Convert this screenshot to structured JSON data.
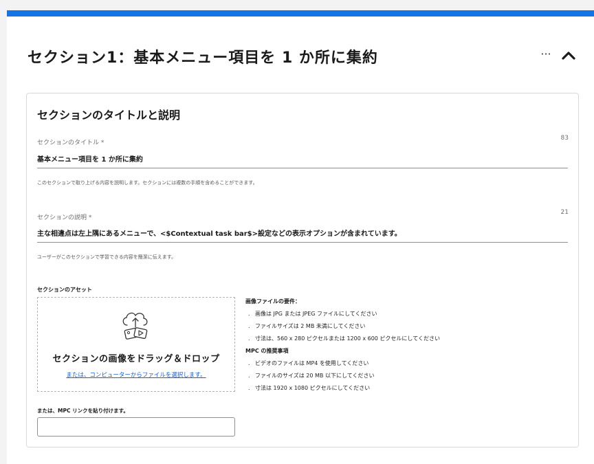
{
  "header": {
    "title": "セクション1：基本メニュー項目を 1 か所に集約",
    "more_label": "···"
  },
  "section": {
    "subtitle": "セクションのタイトルと説明",
    "title_field": {
      "label": "セクションのタイトル *",
      "counter": "83",
      "value": "基本メニュー項目を 1 か所に集約",
      "help": "このセクションで取り上げる内容を説明します。セクションには複数の手順を含めることができます。"
    },
    "description_field": {
      "label": "セクションの説明 *",
      "counter": "21",
      "value": "主な相違点は左上隅にあるメニューで、<$Contextual task bar$>設定などの表示オプションが含まれています。",
      "help": "ユーザーがこのセクションで学習できる内容を簡潔に伝えます。"
    },
    "assets": {
      "label": "セクションのアセット",
      "drop_title": "セクションの画像をドラッグ＆ドロップ",
      "browse_link": "または、コンピューターからファイルを選択します。",
      "mpc_label": "または、MPC リンクを貼り付けます。",
      "mpc_value": ""
    },
    "requirements": {
      "image_heading": "画像ファイルの要件：",
      "image_items": [
        "画像は JPG または JPEG ファイルにしてください",
        "ファイルサイズは 2 MB 未満にしてください",
        "寸法は、560 x 280 ピクセルまたは 1200 x 600 ピクセルにしてください"
      ],
      "mpc_heading": "MPC の推奨事項",
      "mpc_items": [
        "ビデオのファイルは MP4 を使用してください",
        "ファイルのサイズは 20 MB 以下にしてください",
        "寸法は 1920 x 1080 ピクセルにしてください"
      ]
    }
  },
  "colors": {
    "accent": "#1473e6",
    "link": "#1a5fd0"
  }
}
